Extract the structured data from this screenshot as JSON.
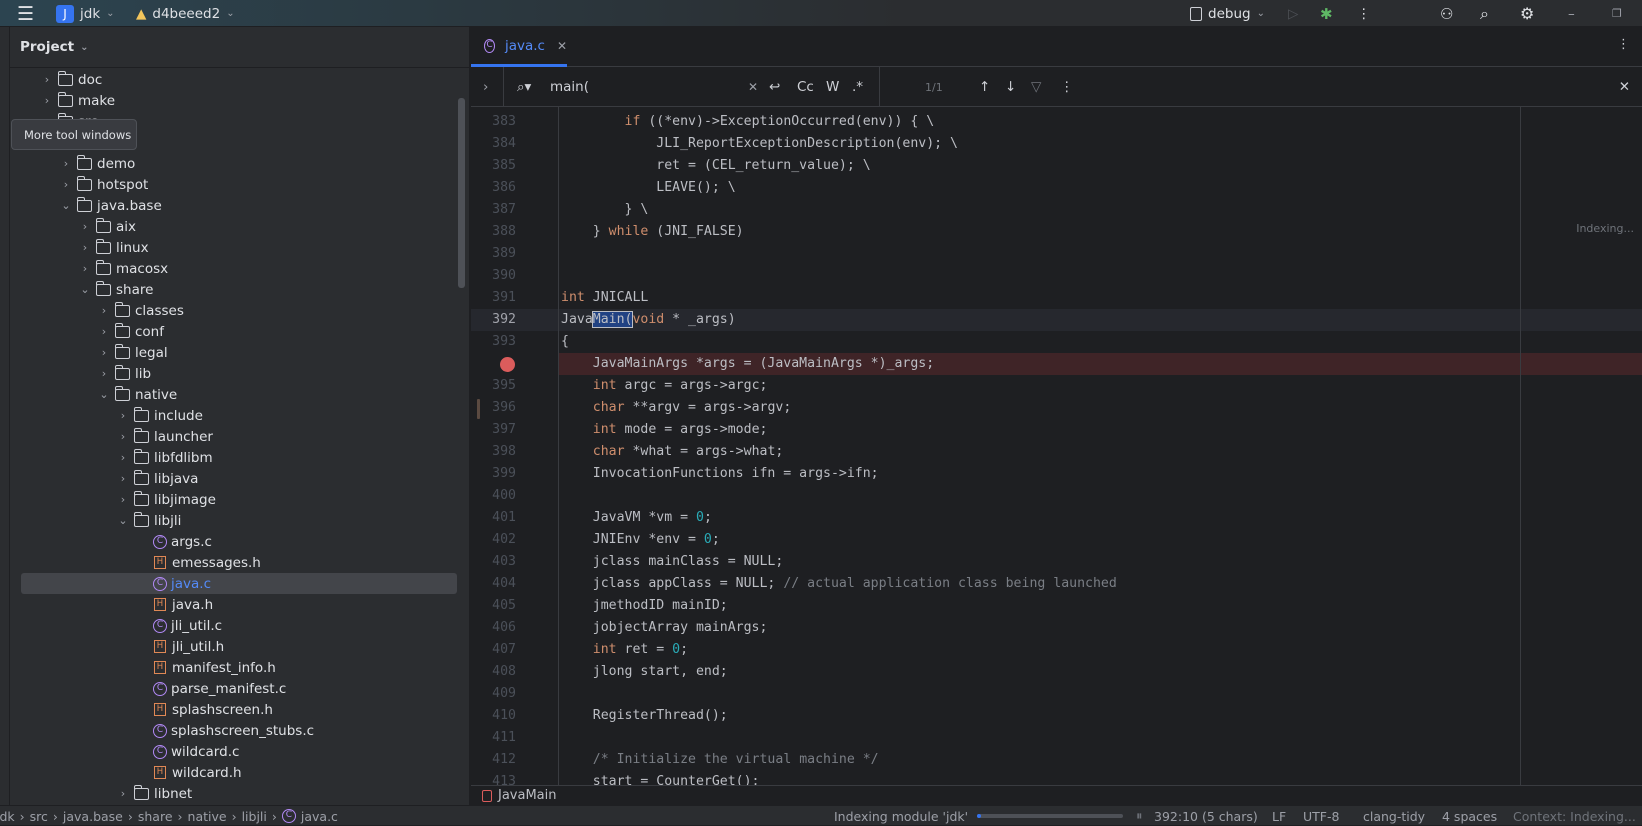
{
  "topbar": {
    "project_initial": "J",
    "project": "jdk",
    "branch": "d4beeed2",
    "run_config": "debug"
  },
  "tooltip": "More tool windows",
  "project_panel": {
    "title": "Project",
    "tree": [
      {
        "label": "doc",
        "kind": "folder",
        "depth": 0,
        "open": false
      },
      {
        "label": "make",
        "kind": "folder",
        "depth": 0,
        "open": false
      },
      {
        "label": "src",
        "kind": "folder",
        "depth": 0,
        "open": true
      },
      {
        "label": "",
        "kind": "hidden",
        "depth": 1
      },
      {
        "label": "demo",
        "kind": "folder",
        "depth": 1,
        "open": false
      },
      {
        "label": "hotspot",
        "kind": "folder",
        "depth": 1,
        "open": false
      },
      {
        "label": "java.base",
        "kind": "folder",
        "depth": 1,
        "open": true
      },
      {
        "label": "aix",
        "kind": "folder",
        "depth": 2,
        "open": false
      },
      {
        "label": "linux",
        "kind": "folder",
        "depth": 2,
        "open": false
      },
      {
        "label": "macosx",
        "kind": "folder",
        "depth": 2,
        "open": false
      },
      {
        "label": "share",
        "kind": "folder",
        "depth": 2,
        "open": true
      },
      {
        "label": "classes",
        "kind": "folder",
        "depth": 3,
        "open": false
      },
      {
        "label": "conf",
        "kind": "folder",
        "depth": 3,
        "open": false
      },
      {
        "label": "legal",
        "kind": "folder",
        "depth": 3,
        "open": false
      },
      {
        "label": "lib",
        "kind": "folder",
        "depth": 3,
        "open": false
      },
      {
        "label": "native",
        "kind": "folder",
        "depth": 3,
        "open": true
      },
      {
        "label": "include",
        "kind": "folder",
        "depth": 4,
        "open": false
      },
      {
        "label": "launcher",
        "kind": "folder",
        "depth": 4,
        "open": false
      },
      {
        "label": "libfdlibm",
        "kind": "folder",
        "depth": 4,
        "open": false
      },
      {
        "label": "libjava",
        "kind": "folder",
        "depth": 4,
        "open": false
      },
      {
        "label": "libjimage",
        "kind": "folder",
        "depth": 4,
        "open": false
      },
      {
        "label": "libjli",
        "kind": "folder",
        "depth": 4,
        "open": true
      },
      {
        "label": "args.c",
        "kind": "c",
        "depth": 5
      },
      {
        "label": "emessages.h",
        "kind": "h",
        "depth": 5
      },
      {
        "label": "java.c",
        "kind": "c",
        "depth": 5,
        "selected": true
      },
      {
        "label": "java.h",
        "kind": "h",
        "depth": 5
      },
      {
        "label": "jli_util.c",
        "kind": "c",
        "depth": 5
      },
      {
        "label": "jli_util.h",
        "kind": "h",
        "depth": 5
      },
      {
        "label": "manifest_info.h",
        "kind": "h",
        "depth": 5
      },
      {
        "label": "parse_manifest.c",
        "kind": "c",
        "depth": 5
      },
      {
        "label": "splashscreen.h",
        "kind": "h",
        "depth": 5
      },
      {
        "label": "splashscreen_stubs.c",
        "kind": "c",
        "depth": 5
      },
      {
        "label": "wildcard.c",
        "kind": "c",
        "depth": 5
      },
      {
        "label": "wildcard.h",
        "kind": "h",
        "depth": 5
      },
      {
        "label": "libnet",
        "kind": "folder",
        "depth": 4,
        "open": false
      }
    ]
  },
  "editor": {
    "tab": "java.c",
    "find": {
      "query": "main(",
      "match_case": "Cc",
      "words": "W",
      "regex": ".*",
      "count": "1/1"
    },
    "indexing": "Indexing...",
    "lines": [
      {
        "n": "383",
        "t": [
          [
            "        ",
            ""
          ],
          [
            "if",
            "kw"
          ],
          [
            " ((*env)->ExceptionOccurred(env)) { \\",
            ""
          ]
        ]
      },
      {
        "n": "384",
        "t": [
          [
            "            JLI_ReportExceptionDescription(env); \\",
            ""
          ]
        ]
      },
      {
        "n": "385",
        "t": [
          [
            "            ret = (CEL_return_value); \\",
            ""
          ]
        ]
      },
      {
        "n": "386",
        "t": [
          [
            "            LEAVE(); \\",
            ""
          ]
        ]
      },
      {
        "n": "387",
        "t": [
          [
            "        } \\",
            ""
          ]
        ]
      },
      {
        "n": "388",
        "t": [
          [
            "    } ",
            ""
          ],
          [
            "while",
            "kw"
          ],
          [
            " (JNI_FALSE)",
            ""
          ]
        ]
      },
      {
        "n": "389",
        "t": []
      },
      {
        "n": "390",
        "t": []
      },
      {
        "n": "391",
        "t": [
          [
            "int",
            "kw"
          ],
          [
            " JNICALL",
            ""
          ]
        ]
      },
      {
        "n": "392",
        "t": [
          [
            "Java",
            ""
          ],
          [
            "Main(",
            "hl"
          ],
          [
            "void",
            "kw"
          ],
          [
            " * _args)",
            ""
          ]
        ],
        "current": true
      },
      {
        "n": "393",
        "t": [
          [
            "{",
            ""
          ]
        ]
      },
      {
        "n": "",
        "t": [
          [
            "    JavaMainArgs *args = (JavaMainArgs *)_args;",
            ""
          ]
        ],
        "breakpoint": true
      },
      {
        "n": "395",
        "t": [
          [
            "    ",
            ""
          ],
          [
            "int",
            "kw"
          ],
          [
            " argc = args->argc;",
            ""
          ]
        ]
      },
      {
        "n": "396",
        "t": [
          [
            "    ",
            ""
          ],
          [
            "char",
            "kw"
          ],
          [
            " **argv = args->argv;",
            ""
          ]
        ]
      },
      {
        "n": "397",
        "t": [
          [
            "    ",
            ""
          ],
          [
            "int",
            "kw"
          ],
          [
            " mode = args->mode;",
            ""
          ]
        ]
      },
      {
        "n": "398",
        "t": [
          [
            "    ",
            ""
          ],
          [
            "char",
            "kw"
          ],
          [
            " *what = args->what;",
            ""
          ]
        ]
      },
      {
        "n": "399",
        "t": [
          [
            "    InvocationFunctions ifn = args->ifn;",
            ""
          ]
        ]
      },
      {
        "n": "400",
        "t": []
      },
      {
        "n": "401",
        "t": [
          [
            "    JavaVM *vm = ",
            ""
          ],
          [
            "0",
            "num"
          ],
          [
            ";",
            ""
          ]
        ]
      },
      {
        "n": "402",
        "t": [
          [
            "    JNIEnv *env = ",
            ""
          ],
          [
            "0",
            "num"
          ],
          [
            ";",
            ""
          ]
        ]
      },
      {
        "n": "403",
        "t": [
          [
            "    jclass mainClass = NULL;",
            ""
          ]
        ]
      },
      {
        "n": "404",
        "t": [
          [
            "    jclass appClass = NULL; ",
            ""
          ],
          [
            "// actual application class being launched",
            "com"
          ]
        ]
      },
      {
        "n": "405",
        "t": [
          [
            "    jmethodID mainID;",
            ""
          ]
        ]
      },
      {
        "n": "406",
        "t": [
          [
            "    jobjectArray mainArgs;",
            ""
          ]
        ]
      },
      {
        "n": "407",
        "t": [
          [
            "    ",
            ""
          ],
          [
            "int",
            "kw"
          ],
          [
            " ret = ",
            ""
          ],
          [
            "0",
            "num"
          ],
          [
            ";",
            ""
          ]
        ]
      },
      {
        "n": "408",
        "t": [
          [
            "    jlong start, end;",
            ""
          ]
        ]
      },
      {
        "n": "409",
        "t": []
      },
      {
        "n": "410",
        "t": [
          [
            "    RegisterThread();",
            ""
          ]
        ]
      },
      {
        "n": "411",
        "t": []
      },
      {
        "n": "412",
        "t": [
          [
            "    ",
            ""
          ],
          [
            "/* Initialize the virtual machine */",
            "com"
          ]
        ]
      },
      {
        "n": "413",
        "t": [
          [
            "    start = CounterGet();",
            ""
          ]
        ]
      }
    ],
    "breadcrumb": "JavaMain"
  },
  "status": {
    "path": [
      "jdk",
      "src",
      "java.base",
      "share",
      "native",
      "libjli",
      "java.c"
    ],
    "task": "Indexing module 'jdk'",
    "progress": 0.03,
    "position": "392:10 (5 chars)",
    "line_sep": "LF",
    "encoding": "UTF-8",
    "inspector": "clang-tidy",
    "indent": "4 spaces",
    "context": "Context: Indexing..."
  },
  "colors": {
    "accent": "#3574f0",
    "keyword": "#cf8e6d",
    "number": "#2aacb8",
    "comment": "#7a7e85",
    "breakpoint": "#db5c5c"
  }
}
